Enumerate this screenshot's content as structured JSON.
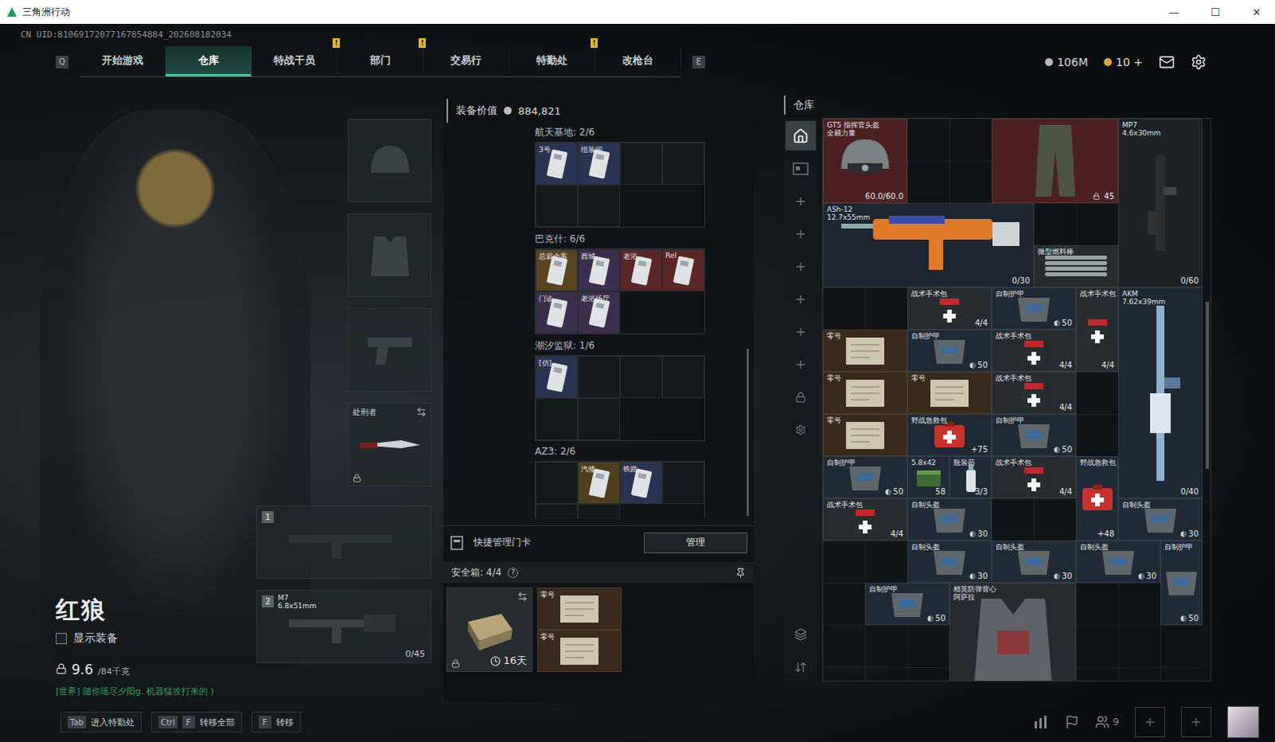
{
  "window": {
    "title": "三角洲行动",
    "controls": [
      "—",
      "☐",
      "✕"
    ]
  },
  "uid": "CN UID:81069172077167854884_202608182034",
  "nav": {
    "left_key": "Q",
    "right_key": "E",
    "badge_text": "!",
    "tabs": [
      {
        "label": "开始游戏",
        "selected": false,
        "badge": false
      },
      {
        "label": "仓库",
        "selected": true,
        "badge": false
      },
      {
        "label": "特战干员",
        "selected": false,
        "badge": true
      },
      {
        "label": "部门",
        "selected": false,
        "badge": true
      },
      {
        "label": "交易行",
        "selected": false,
        "badge": false
      },
      {
        "label": "特勤处",
        "selected": false,
        "badge": true
      },
      {
        "label": "改枪台",
        "selected": false,
        "badge": false
      }
    ]
  },
  "currency": {
    "coins": "106M",
    "tickets": "10",
    "plus": "+"
  },
  "character": {
    "name": "红狼",
    "show_gear": {
      "label": "显示装备",
      "checked": false
    },
    "weight": "9.6",
    "weight_max": "/84千克",
    "chat": "[世界] 随你瑶尽夕阳g. 机器猛攻打来的 )"
  },
  "equipment": {
    "knife": {
      "name": "处刑者",
      "locked": true
    },
    "weapons": [
      {
        "slot": "1",
        "filled": false,
        "name": "",
        "caliber": "",
        "ammo": ""
      },
      {
        "slot": "2",
        "filled": true,
        "name": "M7",
        "caliber": "6.8x51mm",
        "ammo": "0/45"
      }
    ]
  },
  "loadout": {
    "label": "装备价值",
    "value": "884,821"
  },
  "key_sections": [
    {
      "title": "航天基地: 2/6",
      "slots": [
        {
          "filled": true,
          "label": "3号",
          "color": "#2b3352"
        },
        {
          "filled": true,
          "label": "组装间",
          "color": "#2b3352"
        },
        {
          "filled": false
        },
        {
          "filled": false
        },
        {
          "filled": false
        },
        {
          "filled": false
        }
      ]
    },
    {
      "title": "巴克什: 6/6",
      "slots": [
        {
          "filled": true,
          "label": "总裁会客",
          "color": "#5a4420"
        },
        {
          "filled": true,
          "label": "西城",
          "color": "#3b2e4c"
        },
        {
          "filled": true,
          "label": "老浴",
          "color": "#5a2626"
        },
        {
          "filled": true,
          "label": "Rel",
          "color": "#5a2626"
        },
        {
          "filled": true,
          "label": "门诊",
          "color": "#3b2e4c"
        },
        {
          "filled": true,
          "label": "老浴场厅",
          "color": "#3b2e4c"
        }
      ]
    },
    {
      "title": "潮汐监狱: 1/6",
      "slots": [
        {
          "filled": true,
          "label": "[仿]",
          "color": "#2b3352"
        },
        {
          "filled": false
        },
        {
          "filled": false
        },
        {
          "filled": false
        },
        {
          "filled": false
        },
        {
          "filled": false
        }
      ]
    },
    {
      "title": "AZ3: 2/6",
      "slots": [
        {
          "filled": false
        },
        {
          "filled": true,
          "label": "汽修",
          "color": "#4e401e"
        },
        {
          "filled": true,
          "label": "铁路",
          "color": "#2b3352"
        },
        {
          "filled": false
        },
        {
          "filled": false
        },
        {
          "filled": false
        }
      ]
    }
  ],
  "card_manager": {
    "label": "快捷管理门卡",
    "button": "管理"
  },
  "safe_box": {
    "label": "安全箱: 4/4",
    "help": "?",
    "days": "16天",
    "items": [
      {
        "name": "零号"
      },
      {
        "name": "零号"
      }
    ]
  },
  "warehouse": {
    "title": "仓库",
    "side_tabs": [
      {
        "kind": "home",
        "selected": true
      },
      {
        "kind": "card",
        "selected": false
      },
      {
        "kind": "add",
        "selected": false
      },
      {
        "kind": "add",
        "selected": false
      },
      {
        "kind": "add",
        "selected": false
      },
      {
        "kind": "add",
        "selected": false
      },
      {
        "kind": "add",
        "selected": false
      },
      {
        "kind": "add",
        "selected": false
      },
      {
        "kind": "lock",
        "selected": false
      },
      {
        "kind": "gear",
        "selected": false
      },
      {
        "kind": "layers",
        "selected": false
      },
      {
        "kind": "sort",
        "selected": false
      }
    ],
    "items": [
      {
        "kind": "helmet",
        "name": "GT5 指挥官头盔",
        "sub": "全额力量",
        "value": "60.0/60.0",
        "color": "#4c2022",
        "locked": false
      },
      {
        "kind": "pants",
        "name": "",
        "sub": "",
        "value": "45",
        "color": "#4c2022",
        "locked": true
      },
      {
        "kind": "smg",
        "name": "MP7",
        "sub": "4.6x30mm",
        "value": "0/60",
        "color": "#1c2226",
        "locked": false
      },
      {
        "kind": "rifle-h",
        "name": "ASh-12",
        "sub": "12.7x55mm",
        "value": "0/30",
        "color": "#1c2530",
        "locked": false
      },
      {
        "kind": "rod",
        "name": "微型燃料棒",
        "sub": "",
        "value": "",
        "color": "#262b2e",
        "locked": false
      },
      {
        "kind": "kit",
        "name": "战术手术包",
        "sub": "",
        "value": "4/4",
        "color": "#262b30",
        "locked": false
      },
      {
        "kind": "armor",
        "name": "自制护甲",
        "sub": "",
        "value": "50",
        "color": "#1f2a36",
        "locked": false
      },
      {
        "kind": "kit-v",
        "name": "战术手术包",
        "sub": "",
        "value": "4/4",
        "color": "#262b30",
        "locked": false
      },
      {
        "kind": "rifle-v",
        "name": "AKM",
        "sub": "7.62x39mm",
        "value": "0/40",
        "color": "#1d2833",
        "locked": false
      },
      {
        "kind": "doc",
        "name": "零号",
        "sub": "",
        "value": "",
        "color": "#3a2a1c",
        "locked": false
      },
      {
        "kind": "armor",
        "name": "自制护甲",
        "sub": "",
        "value": "50",
        "color": "#1f2a36",
        "locked": false
      },
      {
        "kind": "kit",
        "name": "战术手术包",
        "sub": "",
        "value": "4/4",
        "color": "#262b30",
        "locked": false
      },
      {
        "kind": "doc",
        "name": "零号",
        "sub": "",
        "value": "",
        "color": "#3a2a1c",
        "locked": false
      },
      {
        "kind": "doc",
        "name": "零号",
        "sub": "",
        "value": "",
        "color": "#3a2a1c",
        "locked": false
      },
      {
        "kind": "kit",
        "name": "战术手术包",
        "sub": "",
        "value": "4/4",
        "color": "#262b30",
        "locked": false
      },
      {
        "kind": "doc",
        "name": "零号",
        "sub": "",
        "value": "",
        "color": "#3a2a1c",
        "locked": false
      },
      {
        "kind": "firstaid",
        "name": "野战急救包",
        "sub": "",
        "value": "+75",
        "color": "#1f2a36",
        "locked": false
      },
      {
        "kind": "armor",
        "name": "自制护甲",
        "sub": "",
        "value": "50",
        "color": "#1f2a36",
        "locked": false
      },
      {
        "kind": "armor",
        "name": "自制护甲",
        "sub": "",
        "value": "50",
        "color": "#1f2a36",
        "locked": false
      },
      {
        "kind": "ammo",
        "name": "5.8x42",
        "sub": "",
        "value": "58",
        "color": "#1f2a36",
        "locked": false
      },
      {
        "kind": "spray",
        "name": "瓶装药",
        "sub": "",
        "value": "3/3",
        "color": "#1f2a36",
        "locked": false
      },
      {
        "kind": "kit",
        "name": "战术手术包",
        "sub": "",
        "value": "4/4",
        "color": "#262b30",
        "locked": false
      },
      {
        "kind": "firstaid-v",
        "name": "野战急救包",
        "sub": "",
        "value": "+48",
        "color": "#1f2a36",
        "locked": false
      },
      {
        "kind": "kit",
        "name": "战术手术包",
        "sub": "",
        "value": "4/4",
        "color": "#262b30",
        "locked": false
      },
      {
        "kind": "hat",
        "name": "自制头盔",
        "sub": "",
        "value": "30",
        "color": "#1f2a36",
        "locked": false
      },
      {
        "kind": "hat",
        "name": "自制头盔",
        "sub": "",
        "value": "30",
        "color": "#1f2a36",
        "locked": false
      },
      {
        "kind": "hat",
        "name": "自制头盔",
        "sub": "",
        "value": "30",
        "color": "#1f2a36",
        "locked": false
      },
      {
        "kind": "hat",
        "name": "自制头盔",
        "sub": "",
        "value": "30",
        "color": "#1f2a36",
        "locked": false
      },
      {
        "kind": "hat",
        "name": "自制头盔",
        "sub": "",
        "value": "30",
        "color": "#1f2a36",
        "locked": false
      },
      {
        "kind": "armor-v",
        "name": "自制护甲",
        "sub": "",
        "value": "50",
        "color": "#1f2a36",
        "locked": false
      },
      {
        "kind": "armor",
        "name": "自制护甲",
        "sub": "",
        "value": "50",
        "color": "#1f2a36",
        "locked": false
      },
      {
        "kind": "vest",
        "name": "精英防弹背心",
        "sub": "阿萨拉",
        "value": "",
        "color": "#262b30",
        "locked": false
      }
    ]
  },
  "footer": {
    "hints": [
      {
        "keys": [
          "Tab"
        ],
        "label": "进入特勤处"
      },
      {
        "keys": [
          "Ctrl",
          "F"
        ],
        "label": "转移全部"
      },
      {
        "keys": [
          "F"
        ],
        "label": "转移"
      }
    ],
    "friends": "9"
  }
}
